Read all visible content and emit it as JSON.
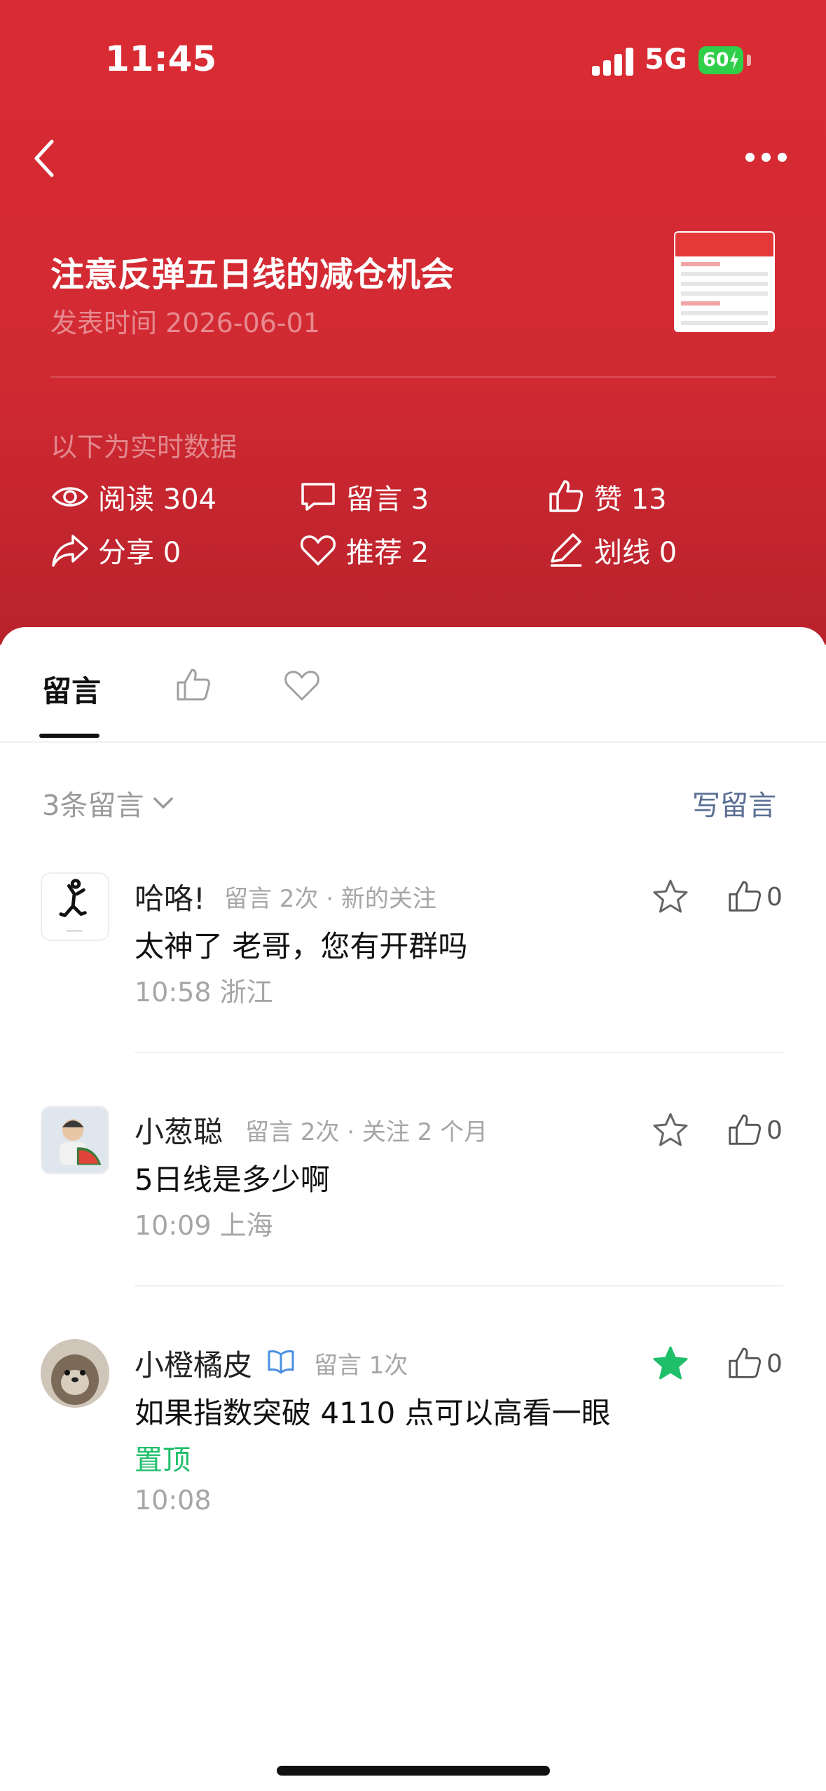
{
  "status_bar": {
    "time": "11:45",
    "network": "5G",
    "battery": "60"
  },
  "article": {
    "title": "注意反弹五日线的减仓机会",
    "date_line": "发表时间 2026-06-01",
    "realtime_label": "以下为实时数据"
  },
  "stats": {
    "read": "阅读 304",
    "comments": "留言 3",
    "likes": "赞 13",
    "shares": "分享 0",
    "recommends": "推荐 2",
    "highlights": "划线 0"
  },
  "tabs": {
    "comments_label": "留言",
    "like_icon": "thumbs-up-icon",
    "heart_icon": "heart-icon"
  },
  "comments_header": {
    "count_label": "3条留言",
    "write_label": "写留言"
  },
  "comments": [
    {
      "name": "哈咯!",
      "meta": "留言 2次 · 新的关注",
      "text": "太神了  老哥，您有开群吗",
      "time_location": "10:58  浙江",
      "likes": "0",
      "starred": false
    },
    {
      "name": "小葱聪",
      "meta": "留言 2次 · 关注 2 个月",
      "text": "5日线是多少啊",
      "time_location": "10:09  上海",
      "likes": "0",
      "starred": false
    },
    {
      "name": "小橙橘皮",
      "meta": "留言 1次",
      "text": "如果指数突破 4110 点可以高看一眼",
      "pinned": "置顶",
      "time_location": "10:08",
      "likes": "0",
      "starred": true
    }
  ],
  "colors": {
    "header_red": "#d92b33",
    "link_blue": "#5a6f93",
    "pin_green": "#1fbf6a",
    "battery_green": "#2fcf4a"
  }
}
